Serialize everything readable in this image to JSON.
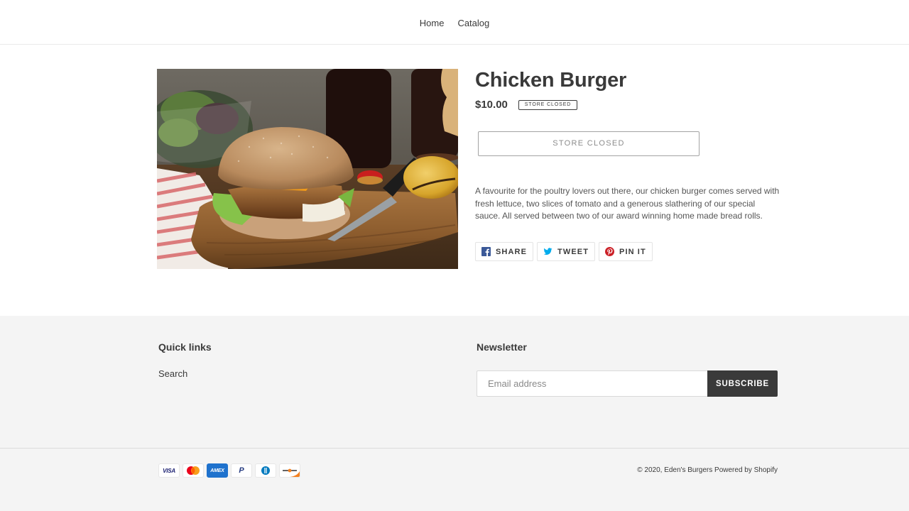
{
  "header": {
    "nav": [
      {
        "label": "Home"
      },
      {
        "label": "Catalog"
      }
    ]
  },
  "product": {
    "image_alt": "Chicken Burger",
    "title": "Chicken Burger",
    "price": "$10.00",
    "badge": "STORE CLOSED",
    "button_label": "STORE CLOSED",
    "description": "A favourite for the poultry lovers out there, our chicken burger comes served with fresh lettuce, two slices of tomato and a generous slathering of our special sauce. All served between two of our award winning home made bread rolls.",
    "share": [
      {
        "label": "SHARE",
        "icon": "facebook-icon",
        "color": "#3b5998"
      },
      {
        "label": "TWEET",
        "icon": "twitter-icon",
        "color": "#00aced"
      },
      {
        "label": "PIN IT",
        "icon": "pinterest-icon",
        "color": "#cb2027"
      }
    ]
  },
  "footer": {
    "quick_links_title": "Quick links",
    "quick_links": [
      {
        "label": "Search"
      }
    ],
    "newsletter_title": "Newsletter",
    "email_placeholder": "Email address",
    "subscribe_label": "SUBSCRIBE",
    "payment_icons": [
      {
        "name": "visa",
        "label": "VISA"
      },
      {
        "name": "mastercard",
        "label": ""
      },
      {
        "name": "amex",
        "label": "AMEX"
      },
      {
        "name": "paypal",
        "label": "P"
      },
      {
        "name": "diners-club",
        "label": ""
      },
      {
        "name": "discover",
        "label": ""
      }
    ],
    "copyright": "© 2020, Eden's Burgers",
    "powered_by": "Powered by Shopify"
  },
  "colors": {
    "text": "#3a3a3a",
    "footer_bg": "#f4f4f4",
    "button_dark": "#3a3a3a"
  }
}
